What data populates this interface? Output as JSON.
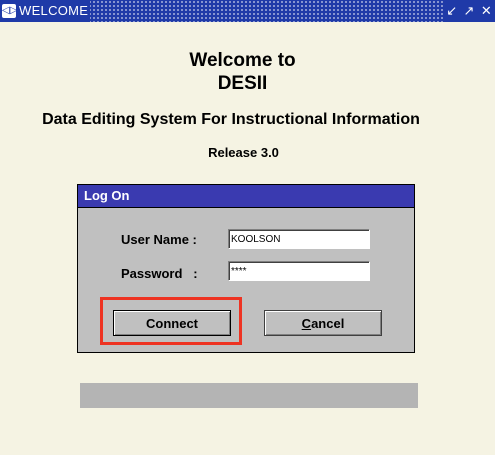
{
  "window": {
    "title": "WELCOME",
    "app_icon_glyph": "◁▷",
    "controls": [
      "↙",
      "↗",
      "✕"
    ]
  },
  "header": {
    "line1": "Welcome to",
    "line2": "DESII",
    "subtitle": "Data Editing System For Instructional Information",
    "release": "Release 3.0"
  },
  "logon": {
    "title": "Log On",
    "username_label": "User Name :",
    "username_value": "KOOLSON",
    "password_label": "Password   :",
    "password_value": "****",
    "connect_label": "Connect",
    "cancel_label": "Cancel"
  },
  "colors": {
    "titlebar": "#1f3aa8",
    "dialog_title": "#3a3ab0",
    "highlight": "#ee3322",
    "background": "#f5f3e3"
  }
}
